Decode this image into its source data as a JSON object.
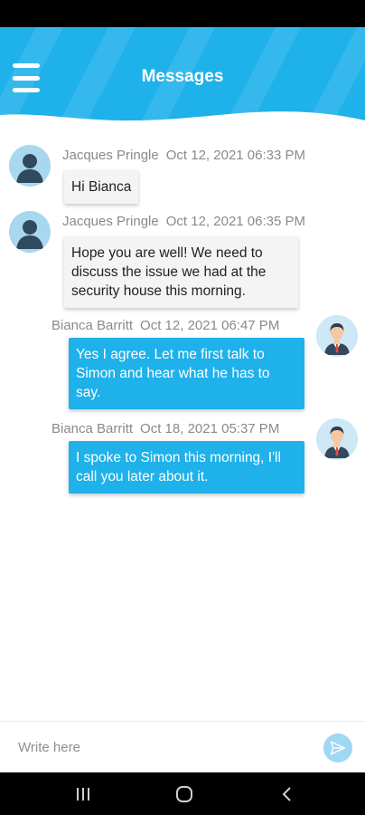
{
  "header": {
    "title": "Messages",
    "menu_icon": "hamburger-menu-icon",
    "color": "#1fb1ea"
  },
  "messages": [
    {
      "sender": "Jacques Pringle",
      "timestamp": "Oct 12, 2021 06:33 PM",
      "text": "Hi Bianca",
      "direction": "incoming",
      "avatar_icon": "person-silhouette-icon"
    },
    {
      "sender": "Jacques Pringle",
      "timestamp": "Oct 12, 2021 06:35 PM",
      "text": "Hope you are well! We need to discuss the issue we had at the security house this morning.",
      "direction": "incoming",
      "avatar_icon": "person-silhouette-icon"
    },
    {
      "sender": "Bianca Barritt",
      "timestamp": "Oct 12, 2021 06:47 PM",
      "text": "Yes I agree. Let me first talk to Simon and hear what he has to say.",
      "direction": "outgoing",
      "avatar_icon": "businessman-avatar-icon"
    },
    {
      "sender": "Bianca Barritt",
      "timestamp": "Oct 18, 2021 05:37 PM",
      "text": "I spoke to Simon this morning, I'll call you later about it.",
      "direction": "outgoing",
      "avatar_icon": "businessman-avatar-icon"
    }
  ],
  "composer": {
    "placeholder": "Write here",
    "value": "",
    "send_icon": "send-paper-plane-icon"
  },
  "navbar": {
    "recents_icon": "recent-apps-icon",
    "home_icon": "home-circle-icon",
    "back_icon": "back-chevron-icon"
  },
  "colors": {
    "accent": "#1fb1ea",
    "incoming_bubble": "#f4f4f4",
    "outgoing_bubble": "#1fb1ea"
  }
}
